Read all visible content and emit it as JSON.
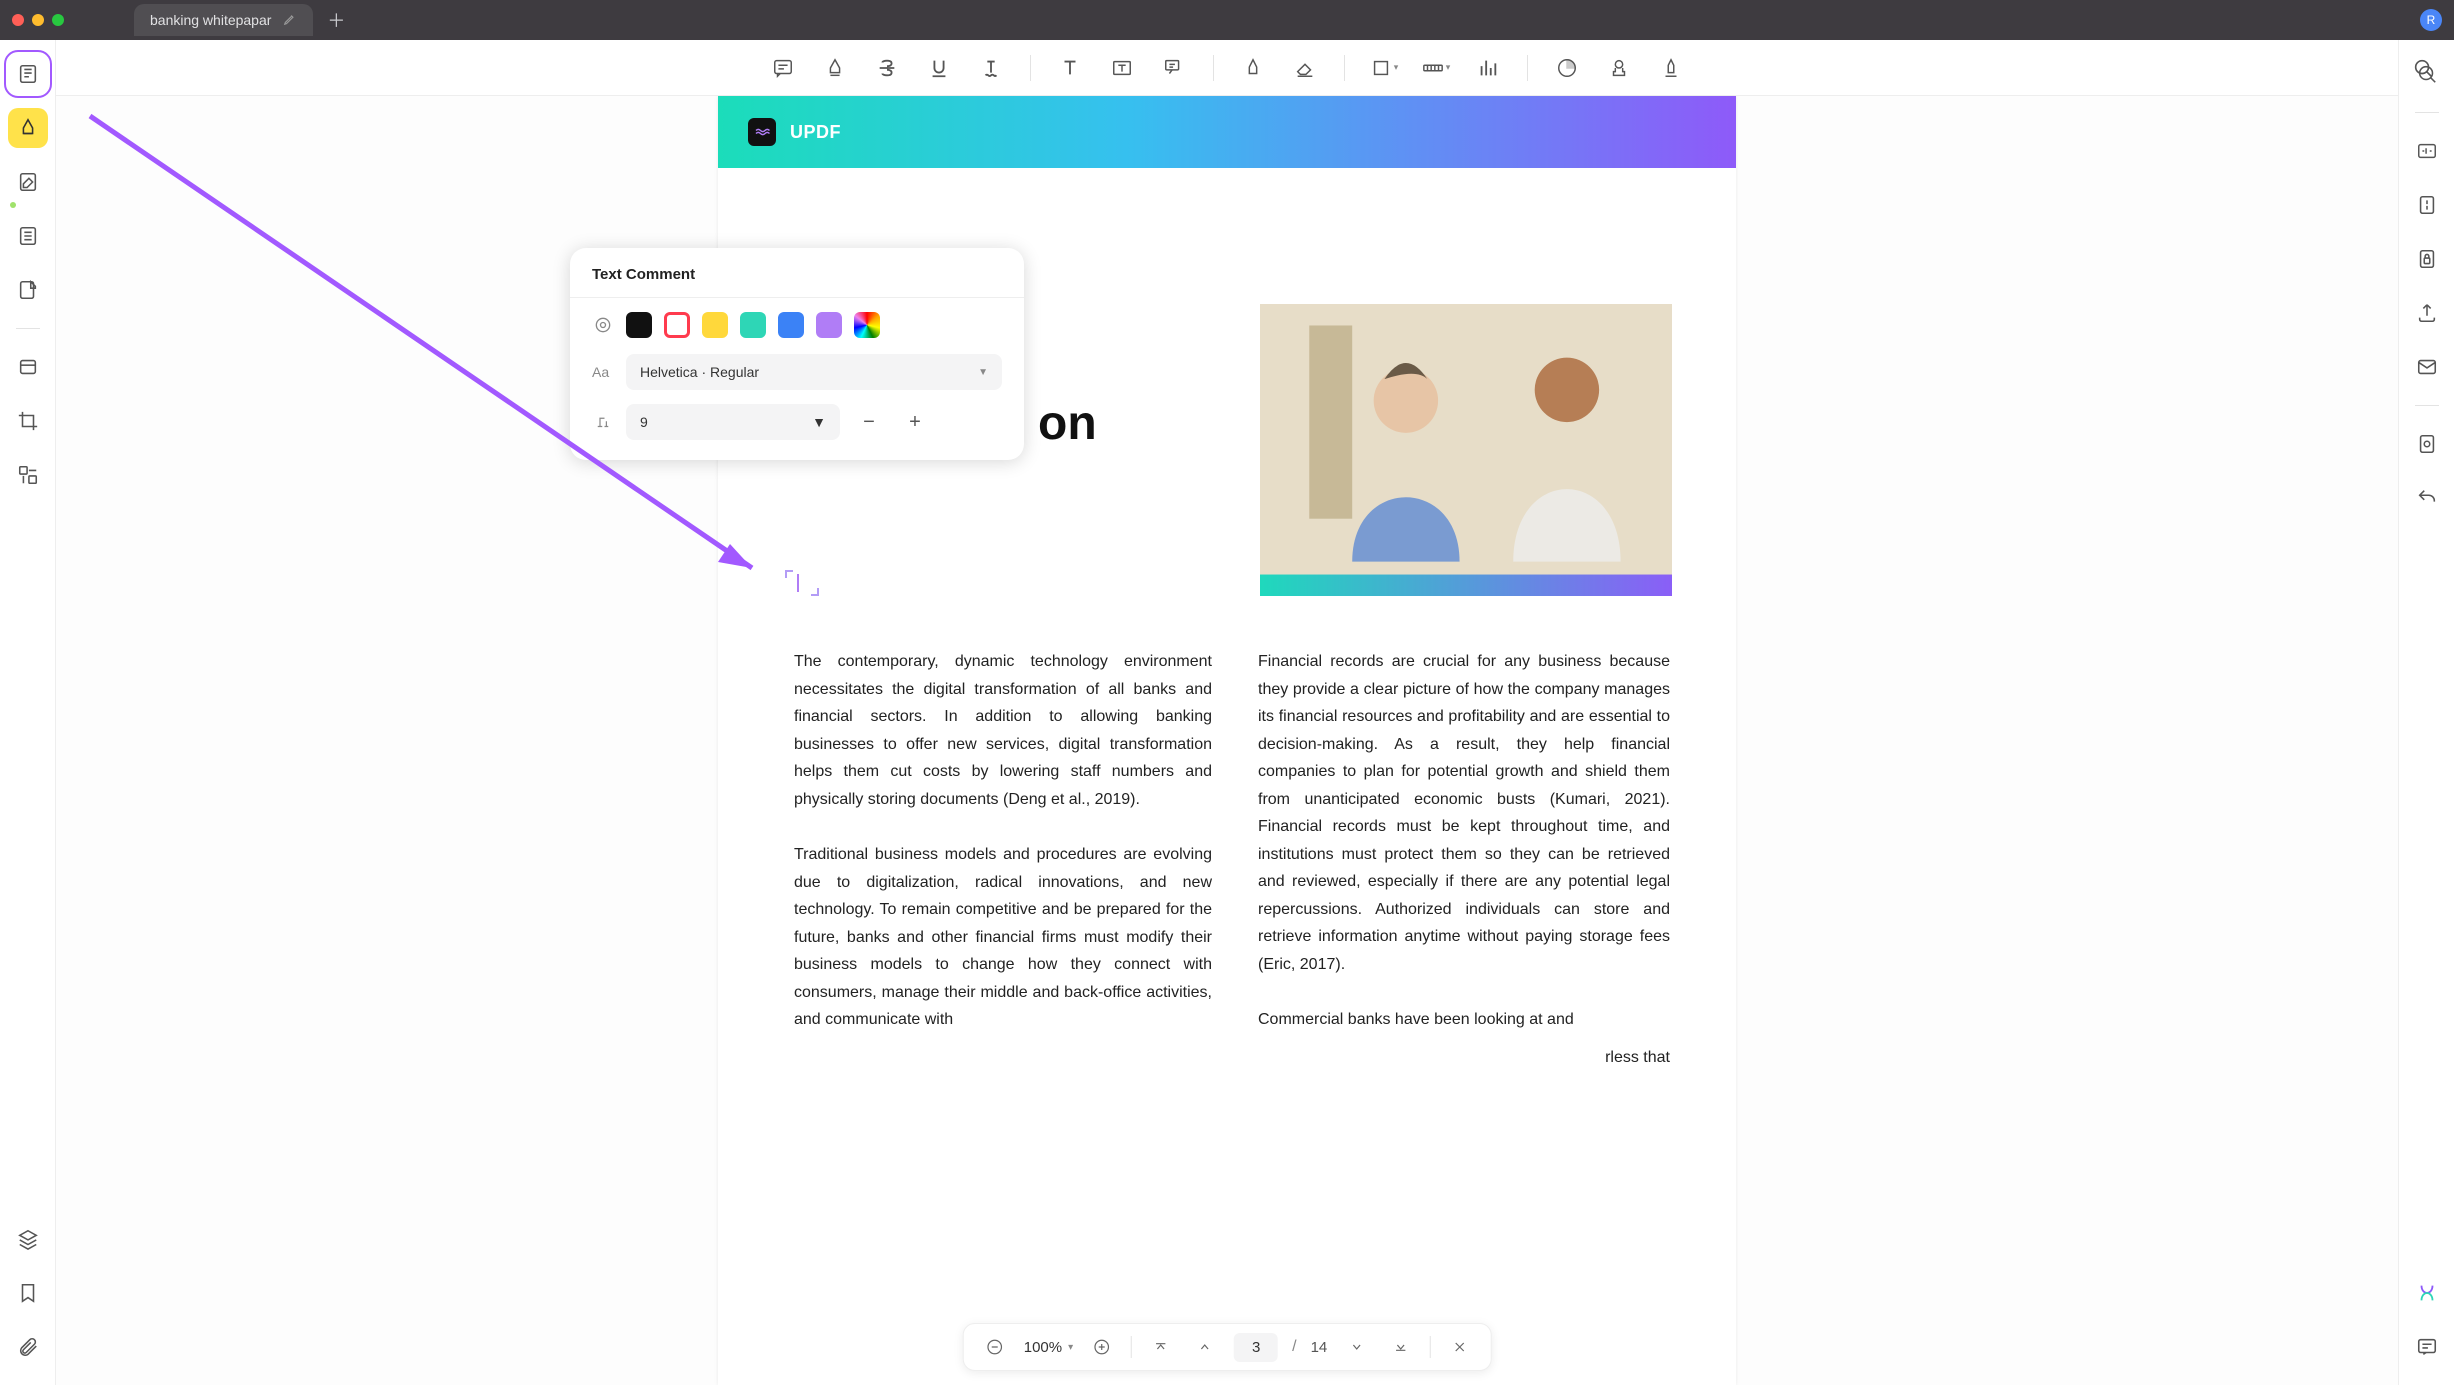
{
  "titlebar": {
    "tab_label": "banking whitepapar",
    "avatar_initial": "R"
  },
  "banner": {
    "brand": "UPDF"
  },
  "headline": "on",
  "popup": {
    "title": "Text Comment",
    "font": "Helvetica · Regular",
    "size": "9"
  },
  "content": {
    "left_p1": "The contemporary, dynamic technology environment necessitates the digital transformation of all banks and financial sectors. In addition to allowing banking businesses to offer new services, digital transformation helps them cut costs by lowering staff numbers and physically storing documents (Deng et al., 2019).",
    "left_p2": "Traditional business models and procedures are evolving due to digitalization, radical innovations, and new technology. To remain competitive and be prepared for the future, banks and other financial firms must modify their business models to change how they connect with consumers, manage their middle and back-office activities, and communicate with",
    "right_p1": "Financial records are crucial for any business because they provide a clear picture of how the company manages its financial resources and profitability and are essential to decision-making. As a result, they help financial companies to plan for potential growth and shield them from unanticipated economic busts (Kumari, 2021). Financial records must be kept throughout time, and institutions must protect them so they can be retrieved and reviewed, especially if there are any potential legal repercussions. Authorized individuals can store and retrieve information anytime without paying storage fees (Eric, 2017).",
    "right_p2": "Commercial banks have been looking at and",
    "right_p3": "rless that"
  },
  "pagenav": {
    "zoom": "100%",
    "current": "3",
    "total": "14",
    "sep": "/"
  }
}
